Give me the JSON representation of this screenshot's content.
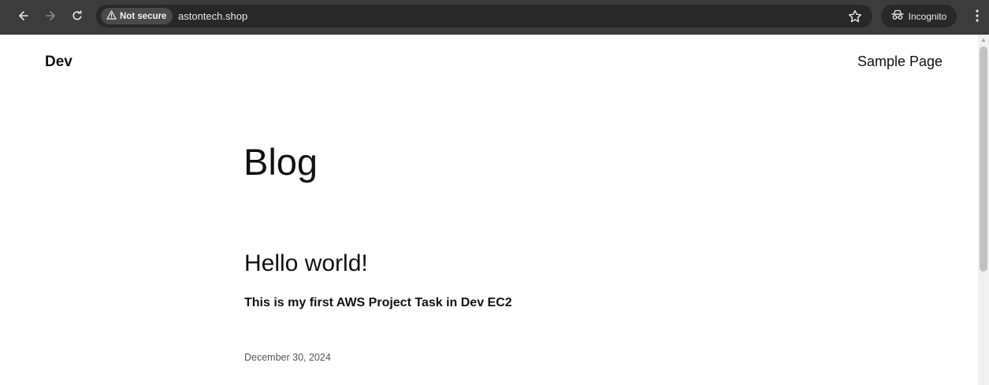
{
  "browser": {
    "security_label": "Not secure",
    "url": "astontech.shop",
    "profile_label": "Incognito",
    "icons": {
      "back": "arrow-left-icon",
      "forward": "arrow-right-icon",
      "reload": "reload-icon",
      "warning": "warning-triangle-icon",
      "bookmark": "star-icon",
      "incognito": "incognito-icon",
      "menu": "kebab-menu-icon"
    },
    "colors": {
      "toolbar": "#3c3c3c",
      "omnibox": "#282828",
      "chip": "#4a4a4a"
    }
  },
  "site": {
    "title": "Dev",
    "nav": [
      {
        "label": "Sample Page"
      }
    ]
  },
  "page": {
    "heading": "Blog"
  },
  "posts": [
    {
      "title": "Hello world!",
      "excerpt": "This is my first AWS Project Task in Dev EC2",
      "date": "December 30, 2024"
    }
  ]
}
